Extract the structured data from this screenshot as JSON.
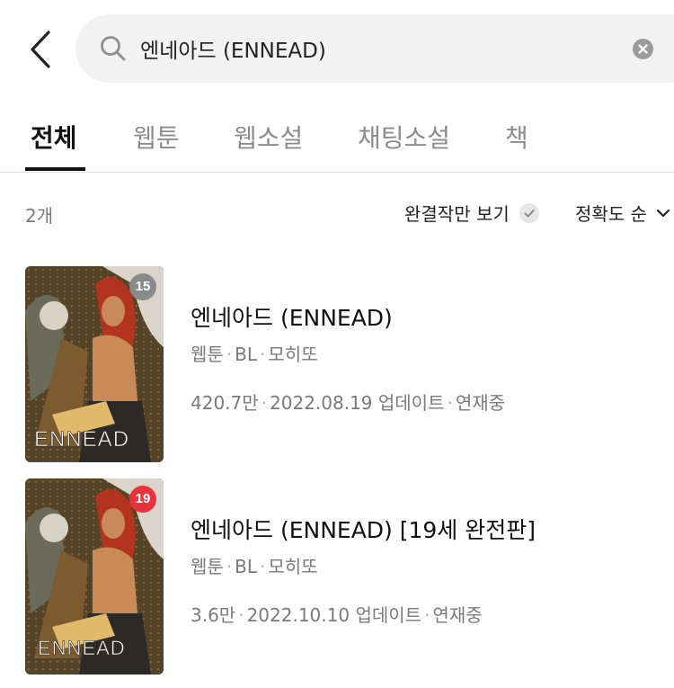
{
  "search": {
    "query": "엔네아드 (ENNEAD)"
  },
  "tabs": [
    {
      "label": "전체",
      "active": true
    },
    {
      "label": "웹툰",
      "active": false
    },
    {
      "label": "웹소설",
      "active": false
    },
    {
      "label": "채팅소설",
      "active": false
    },
    {
      "label": "책",
      "active": false
    }
  ],
  "filters": {
    "count": "2개",
    "complete_only_label": "완결작만 보기",
    "sort_label": "정확도 순"
  },
  "results": [
    {
      "title": "엔네아드 (ENNEAD)",
      "type": "웹툰",
      "genre": "BL",
      "author": "모히또",
      "views": "420.7만",
      "updated": "2022.08.19 업데이트",
      "status": "연재중",
      "age_badge": "15",
      "badge_color": "#8a8a8a",
      "cover_text": "ENNEAD"
    },
    {
      "title": "엔네아드 (ENNEAD) [19세 완전판]",
      "type": "웹툰",
      "genre": "BL",
      "author": "모히또",
      "views": "3.6만",
      "updated": "2022.10.10 업데이트",
      "status": "연재중",
      "age_badge": "19",
      "badge_color": "#e8323c",
      "cover_text": "ENNEAD"
    }
  ]
}
